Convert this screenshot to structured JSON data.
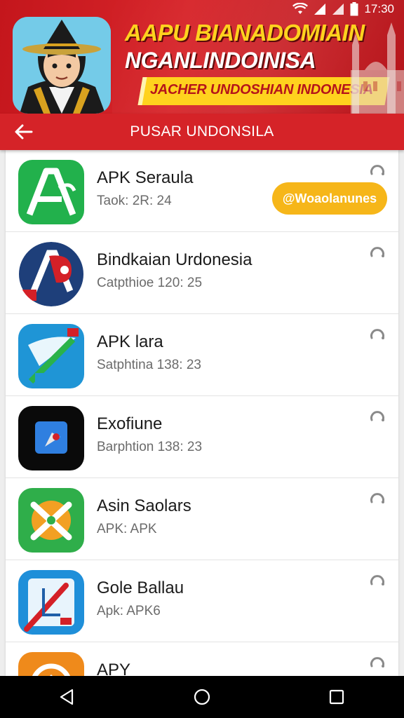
{
  "status_bar": {
    "time": "17:30"
  },
  "banner": {
    "title_line1": "AAPU BIANADOMIAIN",
    "title_line2": "NGANLINDOINISA",
    "tagline": "JACHER UNDOSHIAN INDONESIA"
  },
  "app_bar": {
    "title": "PUSAR UNDONSILA"
  },
  "apps": [
    {
      "title": "APK Seraula",
      "subtitle": "Taok: 2R: 24",
      "action_label": "@Woaolanunes"
    },
    {
      "title": "Bindkaian Urdonesia",
      "subtitle": "Catpthioe 120: 25"
    },
    {
      "title": "APK lara",
      "subtitle": "Satphtina 138: 23"
    },
    {
      "title": "Exofiune",
      "subtitle": "Barphtion 138: 23"
    },
    {
      "title": "Asin Saolars",
      "subtitle": "APK: APK"
    },
    {
      "title": "Gole Ballau",
      "subtitle": "Apk: APK6"
    },
    {
      "title": "APY",
      "subtitle": ""
    }
  ],
  "icons": {
    "back": "arrow-left-icon",
    "item_menu": "refresh-icon",
    "nav": [
      "nav-back-icon",
      "nav-home-icon",
      "nav-recents-icon"
    ]
  },
  "colors": {
    "primary_red": "#d52328",
    "accent_yellow": "#ffd21e",
    "pill": "#f6b619"
  }
}
